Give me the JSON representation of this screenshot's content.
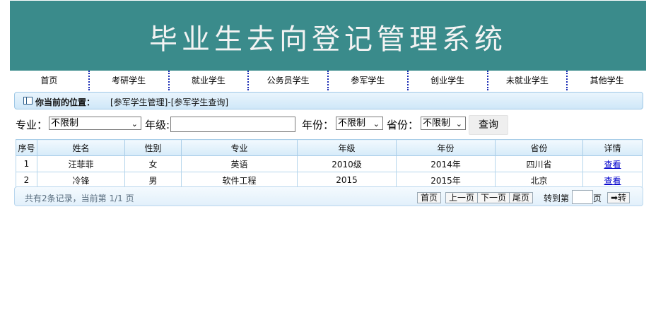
{
  "header": {
    "title": "毕业生去向登记管理系统"
  },
  "nav": {
    "items": [
      {
        "label": "首页"
      },
      {
        "label": "考研学生"
      },
      {
        "label": "就业学生"
      },
      {
        "label": "公务员学生"
      },
      {
        "label": "参军学生"
      },
      {
        "label": "创业学生"
      },
      {
        "label": "未就业学生"
      },
      {
        "label": "其他学生"
      }
    ]
  },
  "location": {
    "label": "你当前的位置：",
    "path": "[参军学生管理]-[参军学生查询]"
  },
  "search": {
    "major_label": "专业：",
    "major_value": "不限制",
    "grade_label": "年级:",
    "grade_value": "",
    "year_label": "年份：",
    "year_value": "不限制",
    "province_label": "省份：",
    "province_value": "不限制",
    "query_button": "查询"
  },
  "table": {
    "headers": [
      "序号",
      "姓名",
      "性别",
      "专业",
      "年级",
      "年份",
      "省份",
      "详情"
    ],
    "rows": [
      [
        "1",
        "汪菲菲",
        "女",
        "英语",
        "2010级",
        "2014年",
        "四川省",
        "查看"
      ],
      [
        "2",
        "冷锋",
        "男",
        "软件工程",
        "2015",
        "2015年",
        "北京",
        "查看"
      ]
    ]
  },
  "pager": {
    "summary": "共有2条记录，当前第 1/1 页",
    "first": "首页",
    "prev": "上一页",
    "next": "下一页",
    "last": "尾页",
    "goto_label": "转到第",
    "page_input": "",
    "page_unit": "页",
    "go_button": "➡转"
  }
}
